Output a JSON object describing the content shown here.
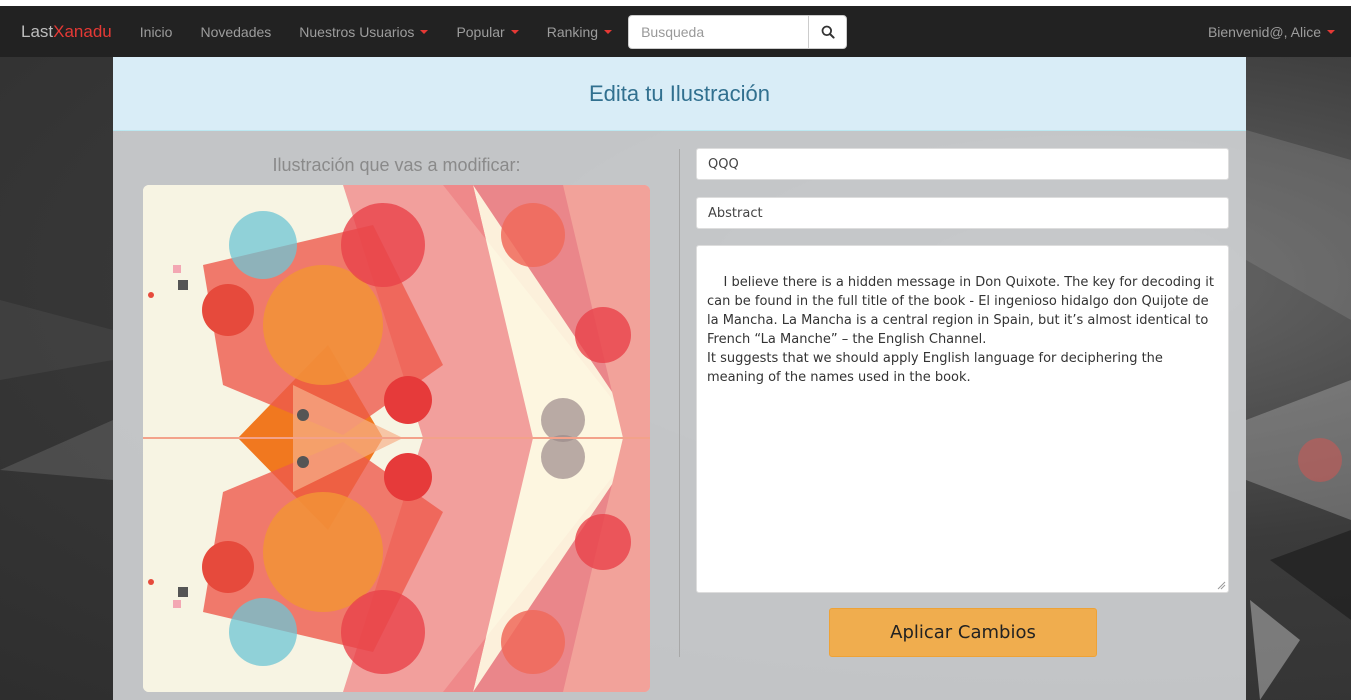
{
  "nav": {
    "brand_left": "Last",
    "brand_right": "Xanadu",
    "items": [
      {
        "label": "Inicio",
        "dropdown": false
      },
      {
        "label": "Novedades",
        "dropdown": false
      },
      {
        "label": "Nuestros Usuarios",
        "dropdown": true
      },
      {
        "label": "Popular",
        "dropdown": true
      },
      {
        "label": "Ranking",
        "dropdown": true
      }
    ],
    "search_placeholder": "Busqueda",
    "search_icon": "search-icon",
    "user_label": "Bienvenid@, Alice"
  },
  "panel": {
    "heading": "Edita tu Ilustración",
    "left_label": "Ilustración que vas a modificar:",
    "title_value": "QQQ",
    "category_value": "Abstract",
    "description_value": "I believe there is a hidden message in Don Quixote. The key for decoding it can be found in the full title of the book - El ingenioso hidalgo don Quijote de la Mancha. La Mancha is a central region in Spain, but it’s almost identical to French “La Manche” – the English Channel.\nIt suggests that we should apply English language for deciphering the meaning of the names used in the book.",
    "apply_label": "Aplicar Cambios"
  },
  "colors": {
    "brand_accent": "#e53935",
    "heading_bg": "#d9edf7",
    "heading_text": "#31708f",
    "button_bg": "#f0ad4e"
  }
}
